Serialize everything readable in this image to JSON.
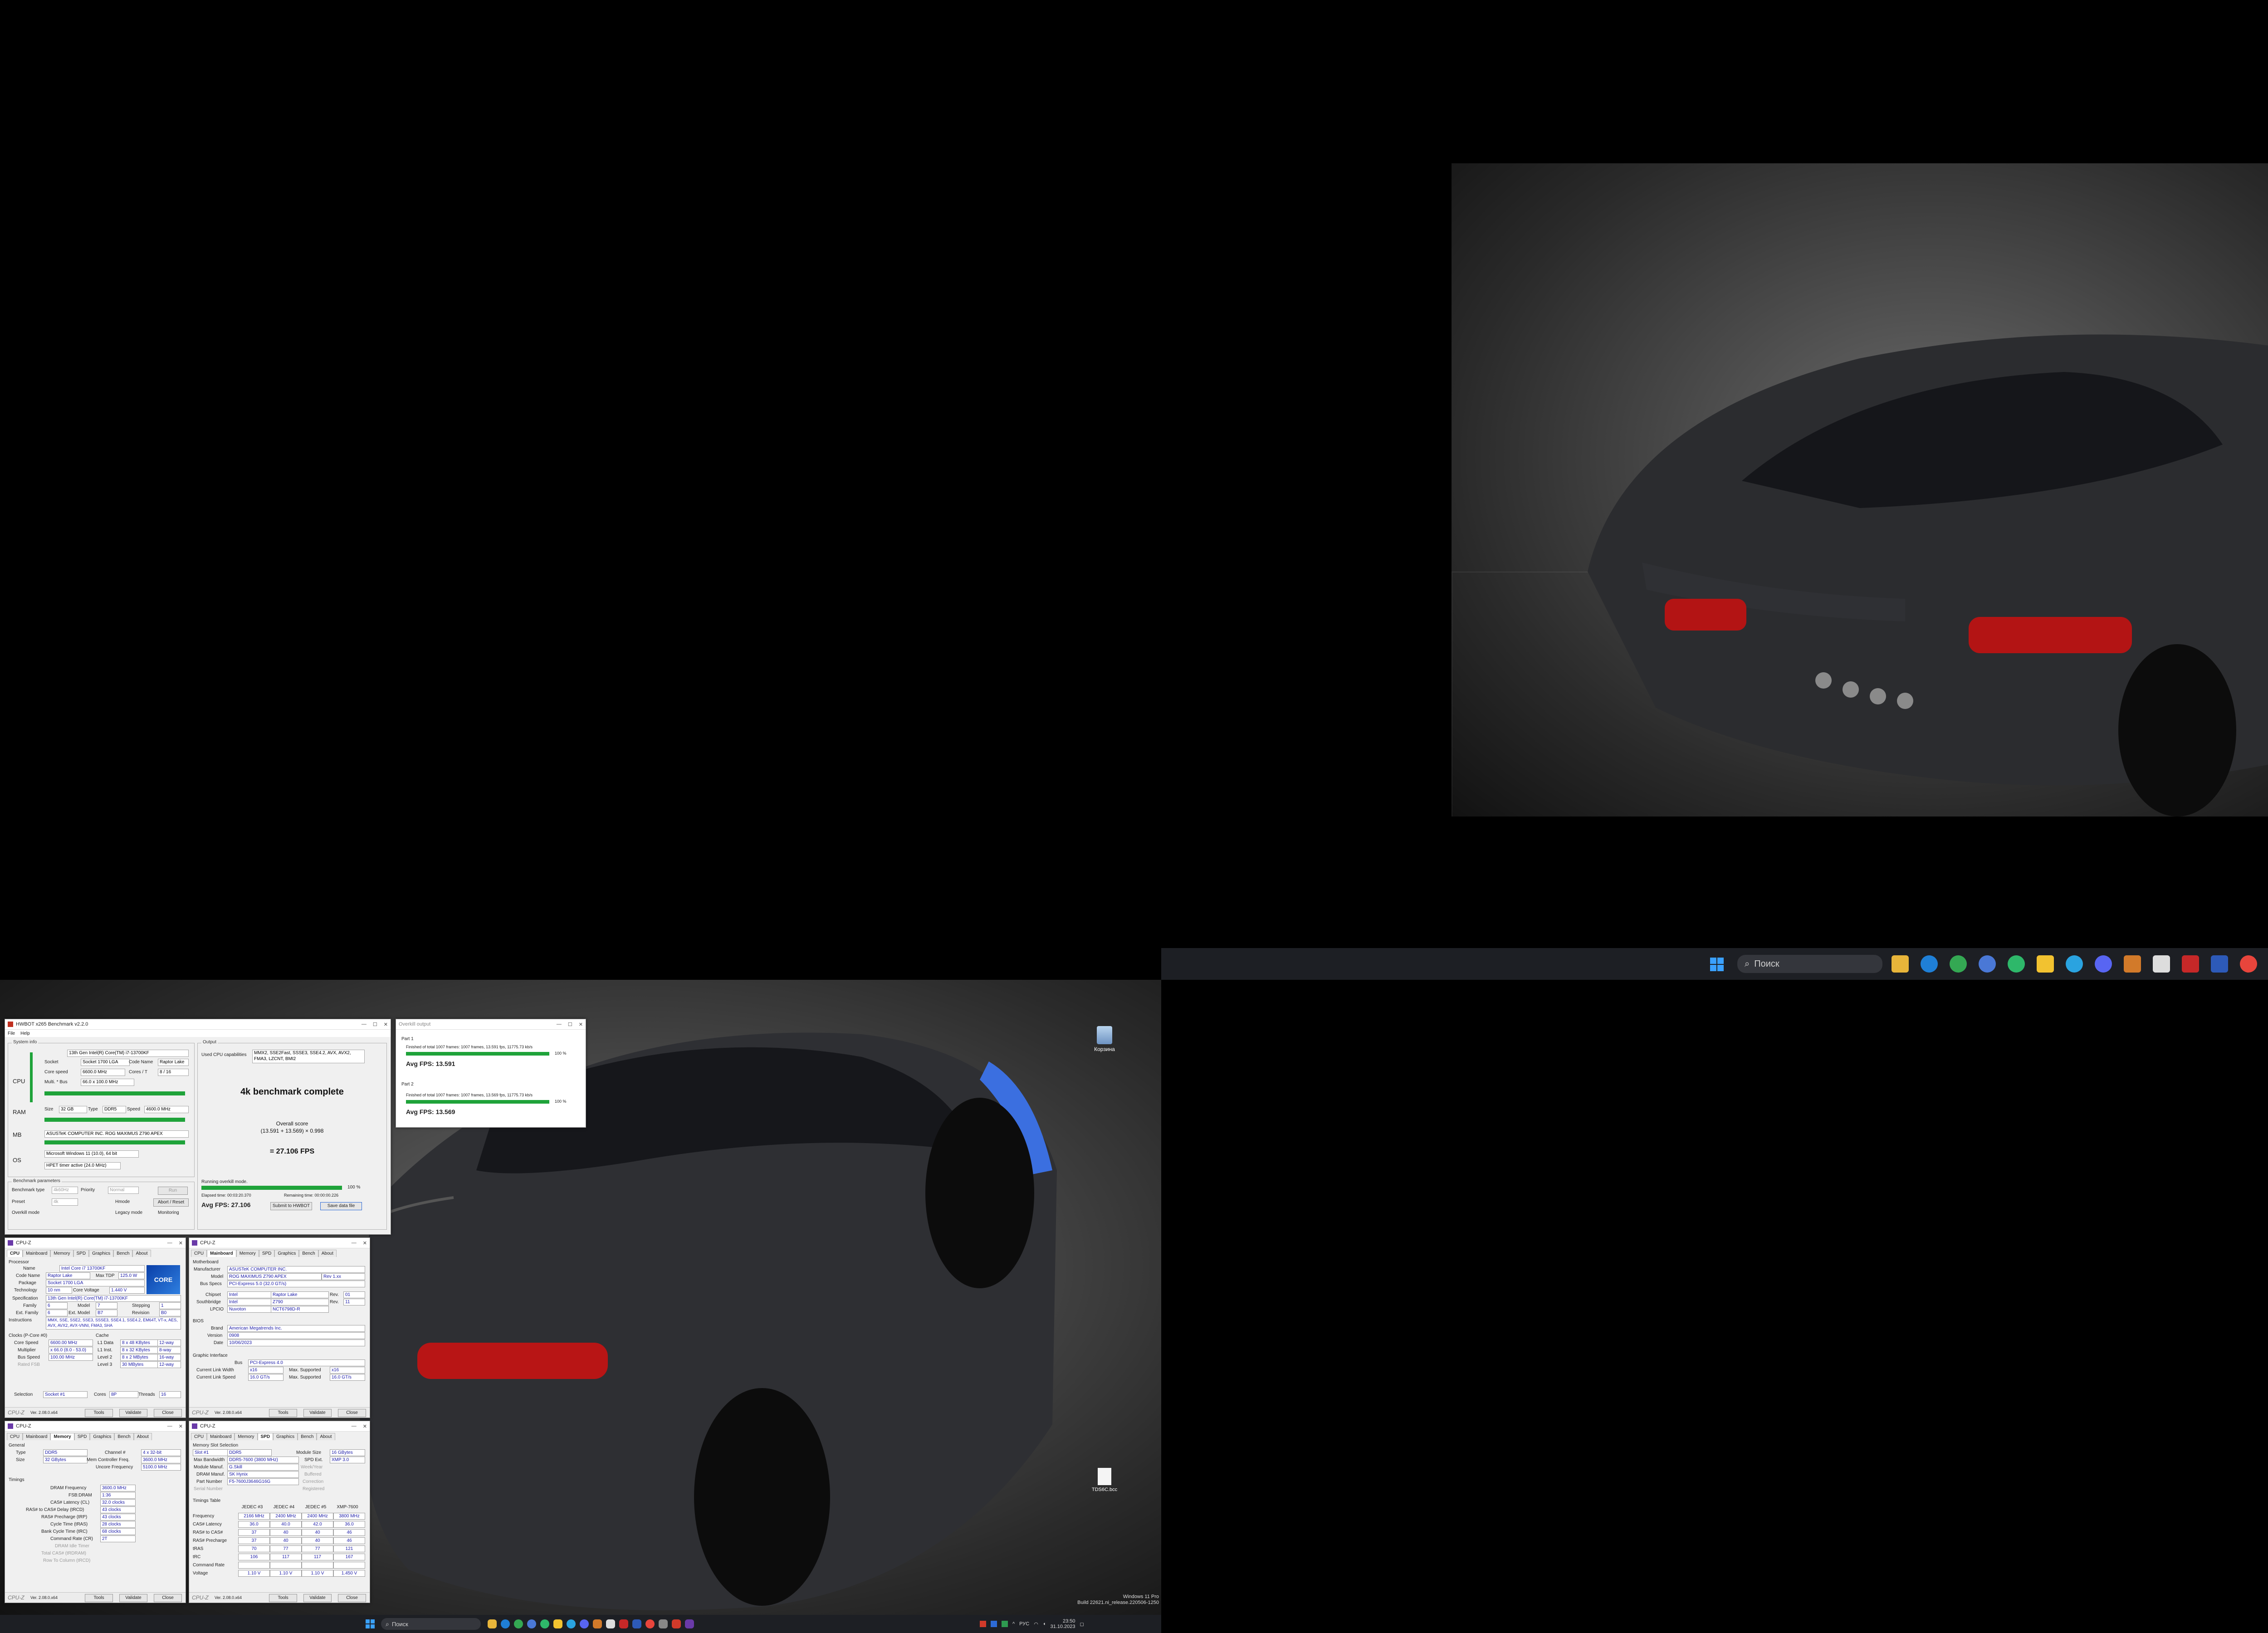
{
  "desktop_icons": {
    "recycle_bin": "Корзина",
    "file": "TDS6C.bcc"
  },
  "taskbar": {
    "search_placeholder": "Поиск",
    "tray_lang": "РУС",
    "clock_time": "23:50",
    "clock_date": "31.10.2023"
  },
  "watermark": {
    "line1": "Windows 11 Pro",
    "line2": "Build 22621.ni_release.220506-1250"
  },
  "hwbot": {
    "title": "HWBOT x265 Benchmark v2.2.0",
    "menu": [
      "File",
      "Help"
    ],
    "system_info_title": "System info",
    "cpu": {
      "label": "CPU",
      "name": "13th Gen Intel(R) Core(TM) i7-13700KF",
      "socket_label": "Socket",
      "socket": "Socket 1700 LGA",
      "codename_label": "Code Name",
      "codename": "Raptor Lake",
      "core_speed_label": "Core speed",
      "core_speed": "6600.0 MHz",
      "cores_label": "Cores / T",
      "cores": "8 / 16",
      "mult_label": "Multi. * Bus",
      "mult": "66.0 x 100.0 MHz"
    },
    "ram": {
      "label": "RAM",
      "size_label": "Size",
      "size": "32 GB",
      "type_label": "Type",
      "type": "DDR5",
      "speed_label": "Speed",
      "speed": "4600.0 MHz"
    },
    "mb": {
      "label": "MB",
      "name": "ASUSTeK COMPUTER INC. ROG MAXIMUS Z790 APEX"
    },
    "os": {
      "label": "OS",
      "name": "Microsoft Windows 11 (10.0), 64 bit",
      "timer": "HPET timer active (24.0 MHz)"
    },
    "bench_params_title": "Benchmark parameters",
    "bench_type_label": "Benchmark type",
    "bench_type": "4k60Hz",
    "priority_label": "Priority",
    "priority": "Normal",
    "preset_label": "Preset",
    "preset": "4k",
    "hmode_label": "Hmode",
    "abort_label": "Abort / Reset",
    "overkill_label": "Overkill mode",
    "legacy_label": "Legacy mode",
    "monitoring_label": "Monitoring",
    "run_label": "Run",
    "output_title": "Output",
    "used_cpu_label": "Used CPU capabilities",
    "used_cpu": "MMX2, SSE2Fast, SSSE3, SSE4.2, AVX, AVX2, FMA3, LZCNT, BMI2",
    "complete": "4k benchmark complete",
    "overall_label": "Overall score",
    "overall_formula": "(13.591 + 13.569) × 0.998",
    "overall_result": "= 27.106 FPS",
    "running_label": "Running overkill mode.",
    "progress_pct": "100 %",
    "progress_value": 1.0,
    "elapsed": "Elapsed time: 00:03:20.370",
    "remaining": "Remaining time: 00:00:00.226",
    "avg_fps": "Avg FPS: 27.106",
    "submit": "Submit to HWBOT",
    "save": "Save data file"
  },
  "overkill": {
    "title": "Overkill output",
    "part1_label": "Part 1",
    "part1_log": "Finished of total 1007 frames: 1007 frames, 13.591 fps, 11775.73 kb/s",
    "part1_pct": "100 %",
    "part1_avg": "Avg FPS: 13.591",
    "part2_label": "Part 2",
    "part2_log": "Finished of total 1007 frames: 1007 frames, 13.569 fps, 11775.73 kb/s",
    "part2_pct": "100 %",
    "part2_avg": "Avg FPS: 13.569"
  },
  "cpuz": {
    "title": "CPU-Z",
    "tabs": [
      "CPU",
      "Mainboard",
      "Memory",
      "SPD",
      "Graphics",
      "Bench",
      "About"
    ],
    "version": "Ver. 2.08.0.x64",
    "tools": "Tools",
    "validate": "Validate",
    "close": "Close",
    "cpu_tab": {
      "processor": "Processor",
      "name_label": "Name",
      "name": "Intel Core i7 13700KF",
      "codename_label": "Code Name",
      "codename": "Raptor Lake",
      "maxtdp_label": "Max TDP",
      "maxtdp": "125.0 W",
      "package_label": "Package",
      "package": "Socket 1700 LGA",
      "technology_label": "Technology",
      "technology": "10 nm",
      "voltage_label": "Core Voltage",
      "voltage": "1.440 V",
      "spec_label": "Specification",
      "spec": "13th Gen Intel(R) Core(TM) i7-13700KF",
      "family_label": "Family",
      "family": "6",
      "model_label": "Model",
      "model": "7",
      "stepping_label": "Stepping",
      "stepping": "1",
      "extfamily_label": "Ext. Family",
      "extfamily": "6",
      "extmodel_label": "Ext. Model",
      "extmodel": "B7",
      "revision_label": "Revision",
      "revision": "B0",
      "instructions_label": "Instructions",
      "instructions": "MMX, SSE, SSE2, SSE3, SSSE3, SSE4.1, SSE4.2, EM64T, VT-x, AES, AVX, AVX2, AVX-VNNI, FMA3, SHA",
      "clocks_label": "Clocks (P-Core #0)",
      "corespeed_label": "Core Speed",
      "corespeed": "6600.00 MHz",
      "multiplier_label": "Multiplier",
      "multiplier": "x 66.0 (8.0 - 53.0)",
      "busspeed_label": "Bus Speed",
      "busspeed": "100.00 MHz",
      "ratedfsb_label": "Rated FSB",
      "cache_label": "Cache",
      "l1d_label": "L1 Data",
      "l1d": "8 x 48 KBytes",
      "l1d_way": "12-way",
      "l1i_label": "L1 Inst.",
      "l1i": "8 x 32 KBytes",
      "l1i_way": "8-way",
      "l2_label": "Level 2",
      "l2": "8 x 2 MBytes",
      "l2_way": "16-way",
      "l3_label": "Level 3",
      "l3": "30 MBytes",
      "l3_way": "12-way",
      "selection_label": "Selection",
      "selection": "Socket #1",
      "cores_label": "Cores",
      "cores": "8P",
      "threads_label": "Threads",
      "threads": "16"
    },
    "mb_tab": {
      "motherboard": "Motherboard",
      "manufacturer_label": "Manufacturer",
      "manufacturer": "ASUSTeK COMPUTER INC.",
      "model_label": "Model",
      "model": "ROG MAXIMUS Z790 APEX",
      "rev": "Rev 1.xx",
      "busspecs_label": "Bus Specs",
      "busspecs": "PCI-Express 5.0 (32.0 GT/s)",
      "chipset_label": "Chipset",
      "chipset": "Intel",
      "chipset2": "Raptor Lake",
      "chipset_rev_label": "Rev.",
      "chipset_rev": "01",
      "southbridge_label": "Southbridge",
      "southbridge": "Intel",
      "southbridge2": "Z790",
      "south_rev": "11",
      "lpcio_label": "LPCIO",
      "lpcio": "Nuvoton",
      "lpcio2": "NCT6798D-R",
      "bios": "BIOS",
      "brand_label": "Brand",
      "brand": "American Megatrends Inc.",
      "version_label": "Version",
      "version": "0908",
      "date_label": "Date",
      "date": "10/06/2023",
      "gi": "Graphic Interface",
      "bus_label": "Bus",
      "bus": "PCI-Express 4.0",
      "clw_label": "Current Link Width",
      "clw": "x16",
      "ms_label": "Max. Supported",
      "ms": "x16",
      "cls_label": "Current Link Speed",
      "cls": "16.0 GT/s",
      "ms2": "16.0 GT/s"
    },
    "mem_tab": {
      "general": "General",
      "type_label": "Type",
      "type": "DDR5",
      "channel_label": "Channel #",
      "channel": "4 x 32-bit",
      "size_label": "Size",
      "size": "32 GBytes",
      "memctrl_label": "Mem Controller Freq.",
      "memctrl": "3600.0 MHz",
      "uncore_label": "Uncore Frequency",
      "uncore": "5100.0 MHz",
      "timings": "Timings",
      "dram_label": "DRAM Frequency",
      "dram": "3600.0 MHz",
      "fsb_label": "FSB:DRAM",
      "fsb": "1:36",
      "cl_label": "CAS# Latency (CL)",
      "cl": "32.0 clocks",
      "trcd_label": "RAS# to CAS# Delay (tRCD)",
      "trcd": "43 clocks",
      "trp_label": "RAS# Precharge (tRP)",
      "trp": "43 clocks",
      "tras_label": "Cycle Time (tRAS)",
      "tras": "28 clocks",
      "trc_label": "Bank Cycle Time (tRC)",
      "trc": "68 clocks",
      "cr_label": "Command Rate (CR)",
      "cr": "2T",
      "idle_label": "DRAM Idle Timer",
      "total_cas_label": "Total CAS# (tRDRAM)",
      "row_label": "Row To Column (tRCD)"
    },
    "spd_tab": {
      "slot_label": "Memory Slot Selection",
      "slot": "Slot #1",
      "slot_type": "DDR5",
      "modsize_label": "Module Size",
      "modsize": "16 GBytes",
      "maxbw_label": "Max Bandwidth",
      "maxbw": "DDR5-7600 (3800 MHz)",
      "spdext_label": "SPD Ext.",
      "spdext": "XMP 3.0",
      "modmanuf_label": "Module Manuf.",
      "modmanuf": "G.Skill",
      "weekyear_label": "Week/Year",
      "drammanuf_label": "DRAM Manuf.",
      "drammanuf": "SK Hynix",
      "buffered_label": "Buffered",
      "partnum_label": "Part Number",
      "partnum": "F5-7600J3646G16G",
      "correction_label": "Correction",
      "serial_label": "Serial Number",
      "registered_label": "Registered",
      "timings_title": "Timings Table",
      "cols": [
        "JEDEC #3",
        "JEDEC #4",
        "JEDEC #5",
        "XMP-7600"
      ],
      "freq_label": "Frequency",
      "freq": [
        "2166 MHz",
        "2400 MHz",
        "2400 MHz",
        "3800 MHz"
      ],
      "cas_label": "CAS# Latency",
      "cas": [
        "36.0",
        "40.0",
        "42.0",
        "36.0"
      ],
      "rcd_label": "RAS# to CAS#",
      "rcd": [
        "37",
        "40",
        "40",
        "46"
      ],
      "rp_label": "RAS# Precharge",
      "rp": [
        "37",
        "40",
        "40",
        "46"
      ],
      "ras_label": "tRAS",
      "ras": [
        "70",
        "77",
        "77",
        "121"
      ],
      "rc_label": "tRC",
      "rc": [
        "106",
        "117",
        "117",
        "167"
      ],
      "cr_label": "Command Rate",
      "volt_label": "Voltage",
      "volt": [
        "1.10 V",
        "1.10 V",
        "1.10 V",
        "1.450 V"
      ]
    }
  }
}
